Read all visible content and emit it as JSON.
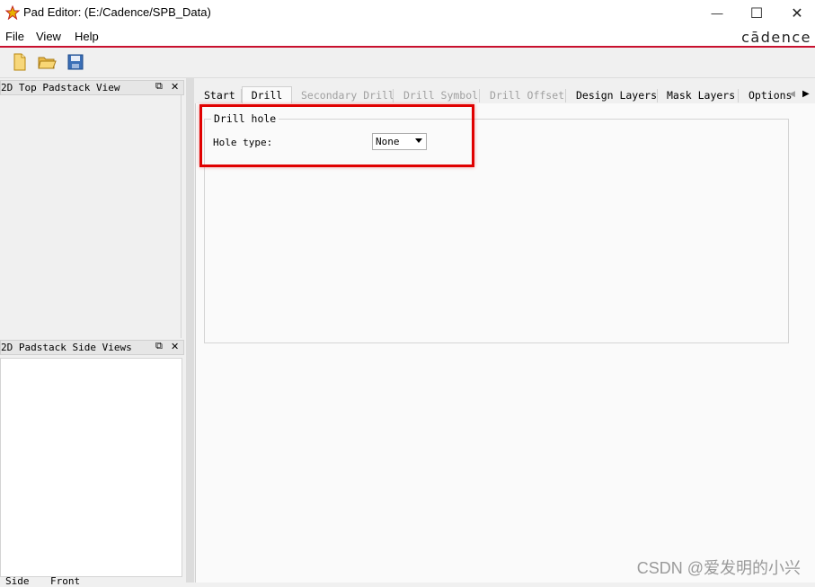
{
  "window": {
    "title": "Pad Editor:   (E:/Cadence/SPB_Data)",
    "minimize_symbol": "—",
    "maximize_symbol": "☐",
    "close_symbol": "✕"
  },
  "menu": {
    "items": [
      "File",
      "View",
      "Help"
    ],
    "brand": "cādence"
  },
  "toolbar": {
    "buttons": [
      {
        "icon": "new-file-icon"
      },
      {
        "icon": "open-folder-icon"
      },
      {
        "icon": "save-icon"
      }
    ]
  },
  "panels": {
    "top_view": {
      "title": "2D Top Padstack View"
    },
    "side_view": {
      "title": "2D Padstack Side Views"
    },
    "float_symbol": "⧉",
    "close_symbol": "✕",
    "bottom_tabs": [
      "Side",
      "Front"
    ]
  },
  "tabs": {
    "items": [
      {
        "label": "Start",
        "state": "normal"
      },
      {
        "label": "Drill",
        "state": "active"
      },
      {
        "label": "Secondary Drill",
        "state": "disabled"
      },
      {
        "label": "Drill Symbol",
        "state": "disabled"
      },
      {
        "label": "Drill Offset",
        "state": "disabled"
      },
      {
        "label": "Design Layers",
        "state": "normal"
      },
      {
        "label": "Mask Layers",
        "state": "normal"
      },
      {
        "label": "Options",
        "state": "normal"
      }
    ],
    "scroll_left": "◀",
    "scroll_right": "▶"
  },
  "drill": {
    "group_title": "Drill hole",
    "hole_type_label": "Hole type:",
    "hole_type_value": "None"
  },
  "watermark": "CSDN @爱发明的小兴",
  "colors": {
    "accent_red": "#c8102e",
    "highlight": "#e00000"
  }
}
